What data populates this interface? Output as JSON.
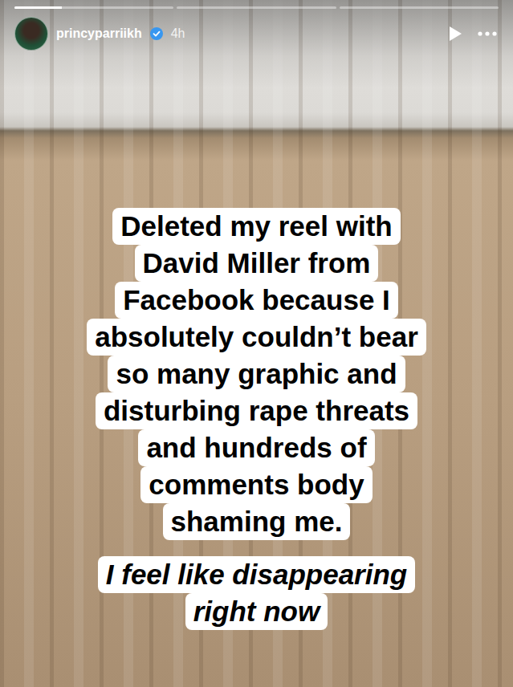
{
  "story": {
    "progress": [
      {
        "level": 0.3
      },
      {
        "level": 0
      },
      {
        "level": 0
      }
    ],
    "username": "princyparriikh",
    "verified": true,
    "time": "4h"
  },
  "stickers": [
    {
      "kind": "regular",
      "lines": [
        "Deleted my reel with",
        "David Miller from",
        "Facebook because I",
        "absolutely couldn’t bear",
        "so many graphic and",
        "disturbing rape threats",
        "and hundreds of",
        "comments body",
        "shaming me."
      ]
    },
    {
      "kind": "italic",
      "lines": [
        "I feel like disappearing",
        "right now"
      ]
    }
  ]
}
